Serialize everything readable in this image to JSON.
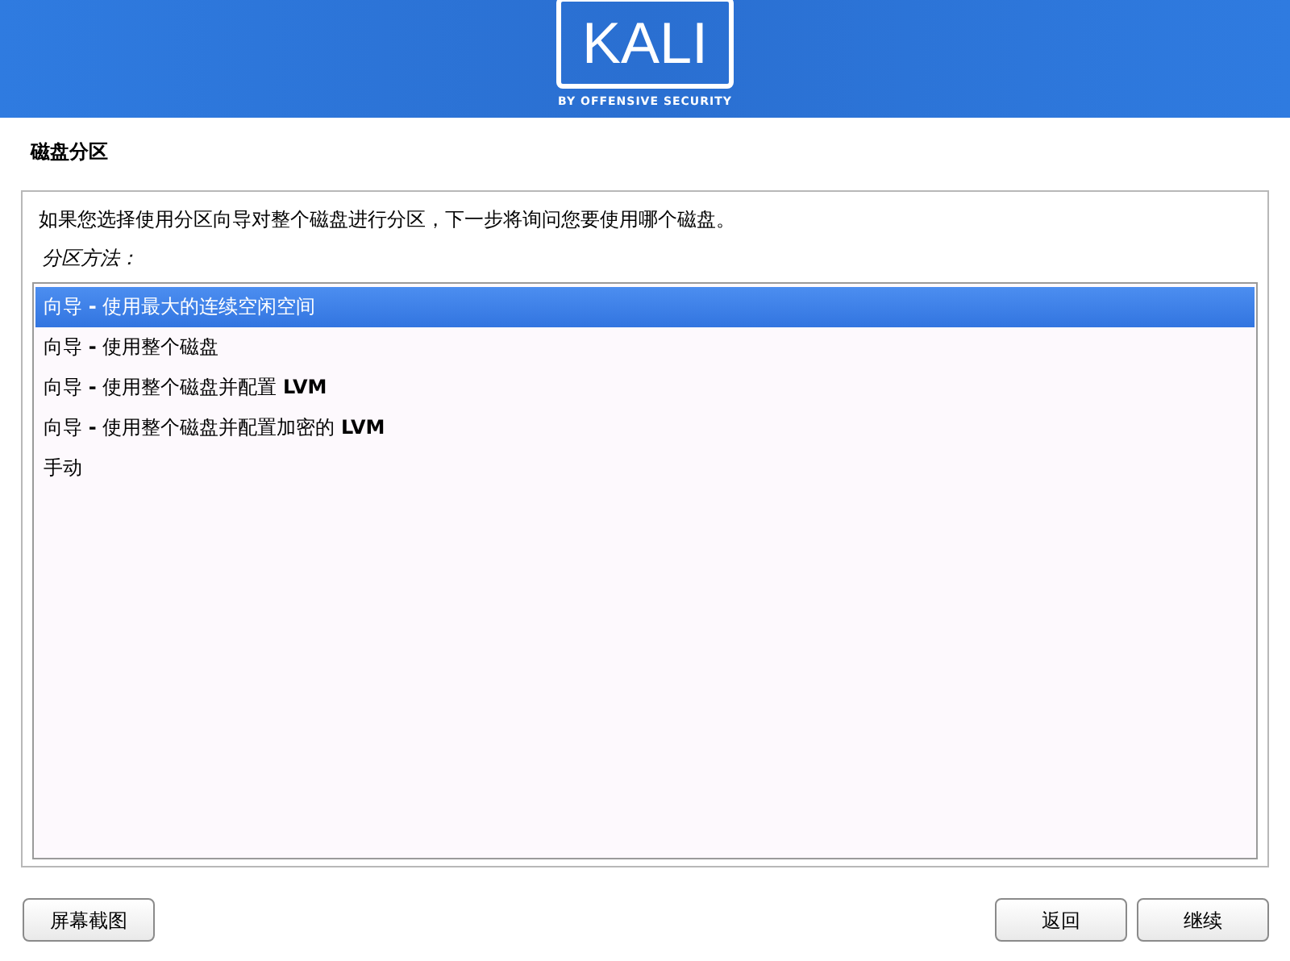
{
  "banner": {
    "logo": "KALI",
    "tagline": "BY OFFENSIVE SECURITY"
  },
  "title": "磁盘分区",
  "description": "如果您选择使用分区向导对整个磁盘进行分区，下一步将询问您要使用哪个磁盘。",
  "list_label": "分区方法：",
  "options": [
    {
      "label": "向导 **-** 使用最大的连续空闲空间",
      "selected": true
    },
    {
      "label": "向导 **-** 使用整个磁盘",
      "selected": false
    },
    {
      "label": "向导 **-** 使用整个磁盘并配置 **LVM**",
      "selected": false
    },
    {
      "label": "向导 **-** 使用整个磁盘并配置加密的 **LVM**",
      "selected": false
    },
    {
      "label": "手动",
      "selected": false
    }
  ],
  "buttons": {
    "screenshot": "屏幕截图",
    "back": "返回",
    "continue": "继续"
  }
}
